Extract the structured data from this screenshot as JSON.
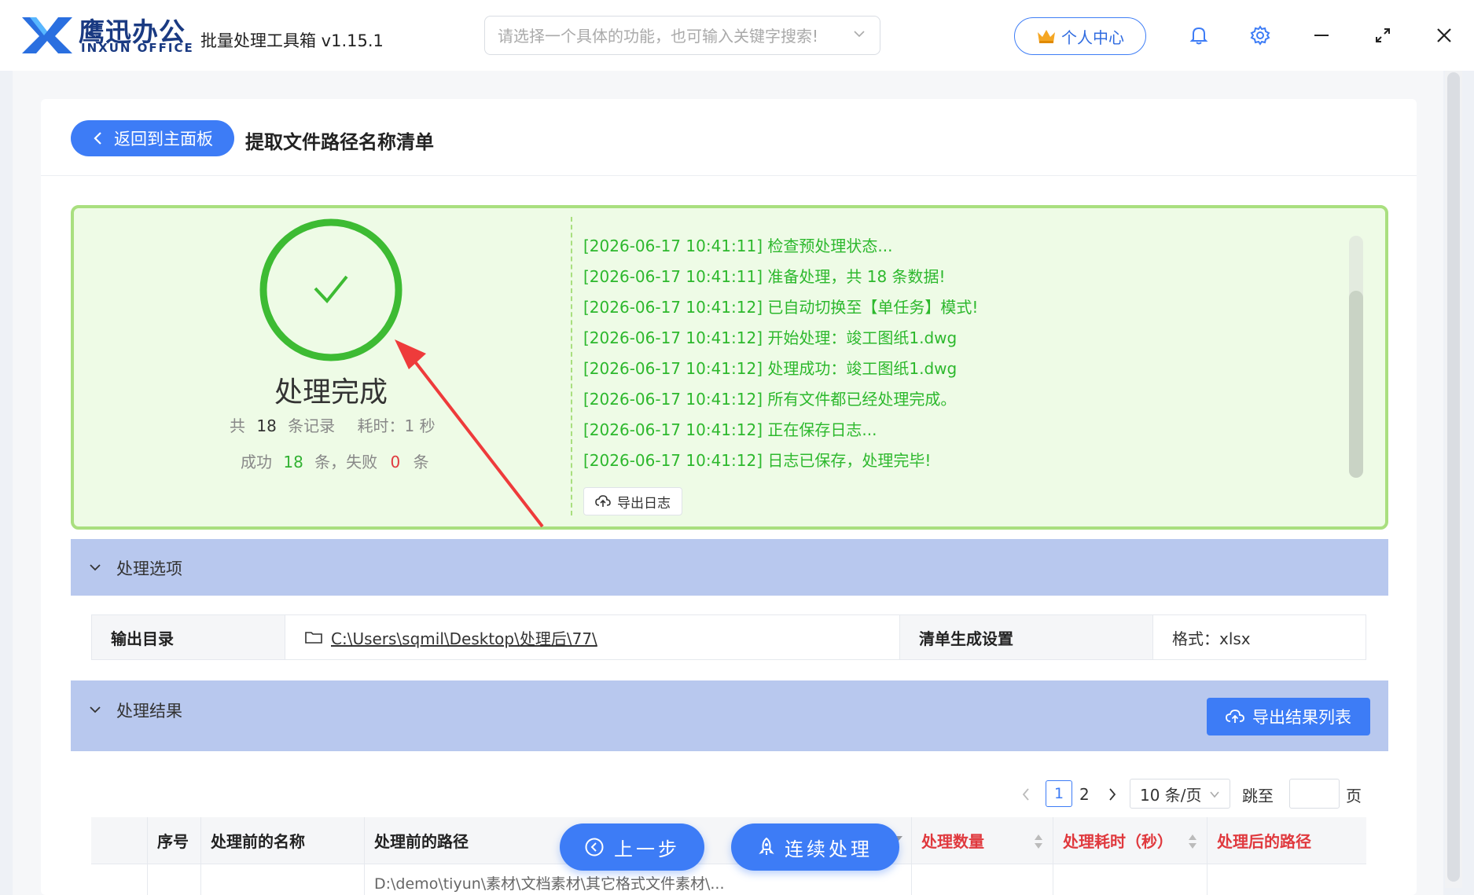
{
  "titlebar": {
    "logo_cn": "鹰迅办公",
    "logo_en": "INXUN OFFICE",
    "app_title": "批量处理工具箱 v1.15.1",
    "search_placeholder": "请选择一个具体的功能，也可输入关键字搜索!",
    "user_center_label": "个人中心"
  },
  "header": {
    "back_label": "返回到主面板",
    "page_title": "提取文件路径名称清单"
  },
  "result": {
    "status_title": "处理完成",
    "total_prefix": "共",
    "total_count": "18",
    "total_suffix": "条记录",
    "time_label": "耗时：1 秒",
    "success_prefix": "成功",
    "success_count": "18",
    "success_suffix": "条，失败",
    "fail_count": "0",
    "fail_suffix": "条",
    "logs": [
      "[2026-06-17 10:41:11] 检查预处理状态...",
      "[2026-06-17 10:41:11] 准备处理，共 18 条数据!",
      "[2026-06-17 10:41:12] 已自动切换至【单任务】模式!",
      "[2026-06-17 10:41:12] 开始处理：竣工图纸1.dwg",
      "[2026-06-17 10:41:12] 处理成功：竣工图纸1.dwg",
      "[2026-06-17 10:41:12] 所有文件都已经处理完成。",
      "[2026-06-17 10:41:12] 正在保存日志...",
      "[2026-06-17 10:41:12] 日志已保存，处理完毕!"
    ],
    "export_log_label": "导出日志"
  },
  "options": {
    "section_title": "处理选项",
    "output_dir_label": "输出目录",
    "output_dir_value": "C:\\Users\\sqmil\\Desktop\\处理后\\77\\",
    "list_setting_label": "清单生成设置",
    "format_value": "格式：xlsx"
  },
  "results_section": {
    "section_title": "处理结果",
    "export_list_label": "导出结果列表",
    "pager": {
      "current_page": "1",
      "page_2": "2",
      "page_size": "10 条/页",
      "jump_label": "跳至",
      "page_unit": "页"
    },
    "columns": [
      "序号",
      "处理前的名称",
      "处理前的路径",
      "处理数量",
      "处理耗时（秒）",
      "处理后的路径"
    ],
    "partial_row_path": "D:\\demo\\tiyun\\素材\\文档素材\\其它格式文件素材\\..."
  },
  "floating": {
    "prev_label": "上一步",
    "continue_label": "连续处理"
  },
  "colors": {
    "primary": "#3d7cf6",
    "success": "#33b233",
    "danger": "#e0393e",
    "section_bg": "#b8c8ee",
    "result_bg": "#eefbe6"
  }
}
